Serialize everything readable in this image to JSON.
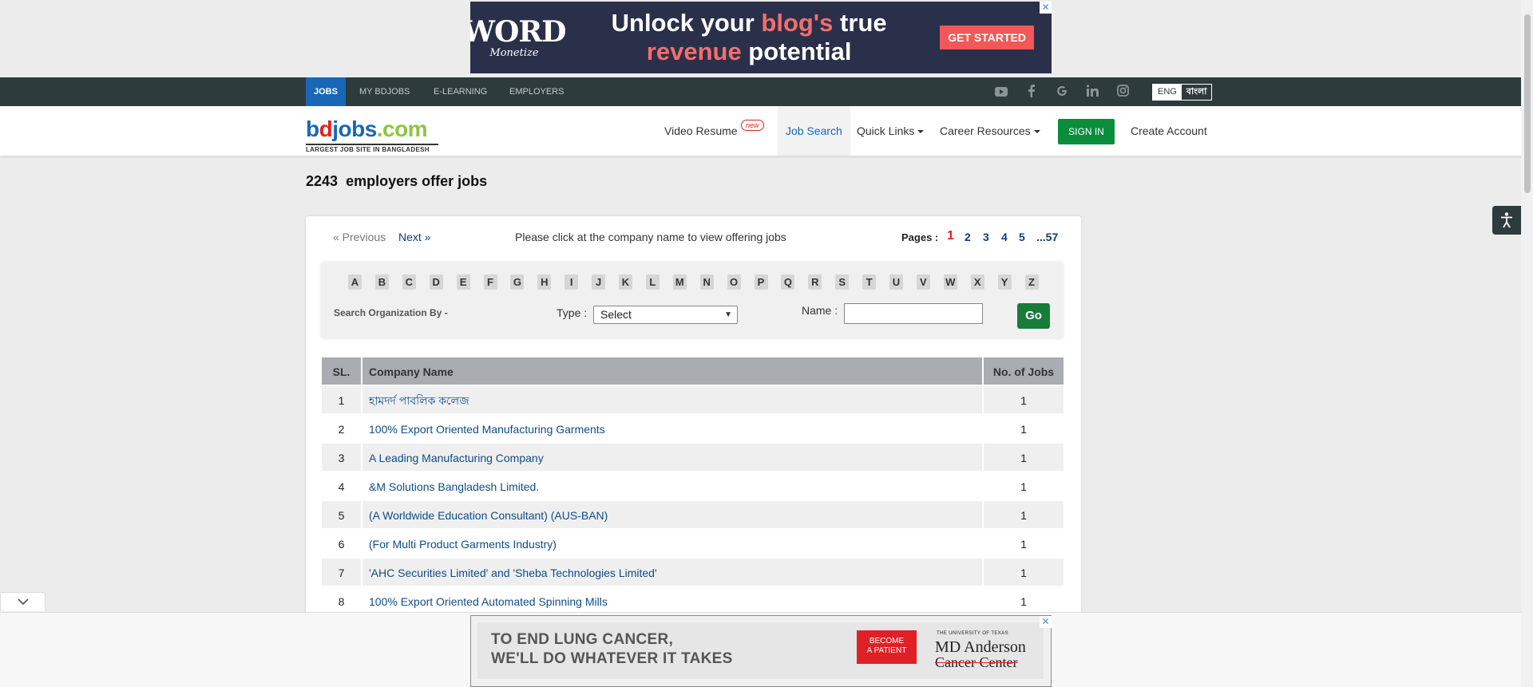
{
  "top_ad": {
    "logo_big": "WORD",
    "logo_small": "Monetize",
    "headline_part1": "Unlock your ",
    "headline_accent1": "blog's",
    "headline_part2": " true",
    "headline_accent2": "revenue",
    "headline_part3": " potential",
    "cta": "GET STARTED",
    "close": "✕"
  },
  "topnav": {
    "items": [
      "JOBS",
      "MY BDJOBS",
      "E-LEARNING",
      "EMPLOYERS"
    ],
    "social_icons": [
      "youtube-icon",
      "facebook-icon",
      "google-icon",
      "linkedin-icon",
      "instagram-icon"
    ],
    "lang_eng": "ENG",
    "lang_bn": "বাংলা"
  },
  "header": {
    "brand_b": "b",
    "brand_d": "d",
    "brand_jobs": "jobs",
    "brand_com": ".com",
    "brand_tag": "LARGEST JOB SITE IN BANGLADESH",
    "video_resume": "Video Resume",
    "new_badge": "new",
    "job_search": "Job Search",
    "quick_links": "Quick Links",
    "career_resources": "Career Resources",
    "sign_in": "SIGN IN",
    "create_account": "Create Account"
  },
  "page": {
    "count": "2243",
    "title_rest": "employers offer jobs"
  },
  "pager": {
    "previous": "« Previous",
    "next": "Next »",
    "hint": "Please click at the company name to view offering jobs",
    "pages_label": "Pages :",
    "pages": [
      "1",
      "2",
      "3",
      "4",
      "5",
      "...57"
    ],
    "current": "1"
  },
  "filter": {
    "letters": [
      "A",
      "B",
      "C",
      "D",
      "E",
      "F",
      "G",
      "H",
      "I",
      "J",
      "K",
      "L",
      "M",
      "N",
      "O",
      "P",
      "Q",
      "R",
      "S",
      "T",
      "U",
      "V",
      "W",
      "X",
      "Y",
      "Z"
    ],
    "search_by": "Search Organization By -",
    "type_label": "Type :",
    "type_value": "Select",
    "name_label": "Name :",
    "name_value": "",
    "go": "Go"
  },
  "table": {
    "headers": {
      "sl": "SL.",
      "name": "Company Name",
      "jobs": "No. of Jobs"
    },
    "rows": [
      {
        "sl": "1",
        "name": "হামদর্দ পাবলিক কলেজ",
        "jobs": "1"
      },
      {
        "sl": "2",
        "name": "100% Export Oriented Manufacturing Garments",
        "jobs": "1"
      },
      {
        "sl": "3",
        "name": "A Leading Manufacturing Company",
        "jobs": "1"
      },
      {
        "sl": "4",
        "name": "&M Solutions Bangladesh Limited.",
        "jobs": "1"
      },
      {
        "sl": "5",
        "name": "(A Worldwide Education Consultant) (AUS-BAN)",
        "jobs": "1"
      },
      {
        "sl": "6",
        "name": "(For Multi Product Garments Industry)",
        "jobs": "1"
      },
      {
        "sl": "7",
        "name": "'AHC Securities Limited' and 'Sheba Technologies Limited'",
        "jobs": "1"
      },
      {
        "sl": "8",
        "name": "100% Export Oriented Automated Spinning Mills",
        "jobs": "1"
      }
    ]
  },
  "bottom_ad": {
    "line1": "TO END LUNG CANCER,",
    "line2": "WE'LL DO WHATEVER IT TAKES",
    "cta_line1": "BECOME",
    "cta_line2": "A PATIENT",
    "inst_small": "THE UNIVERSITY OF TEXAS",
    "inst1": "MD Anderson",
    "inst2": "Cancer Center",
    "close": "✕"
  },
  "colors": {
    "accent_blue": "#1868b7",
    "signin_green": "#0a8e3c",
    "current_page_red": "#e2231a",
    "link_blue": "#0f4c8a"
  }
}
